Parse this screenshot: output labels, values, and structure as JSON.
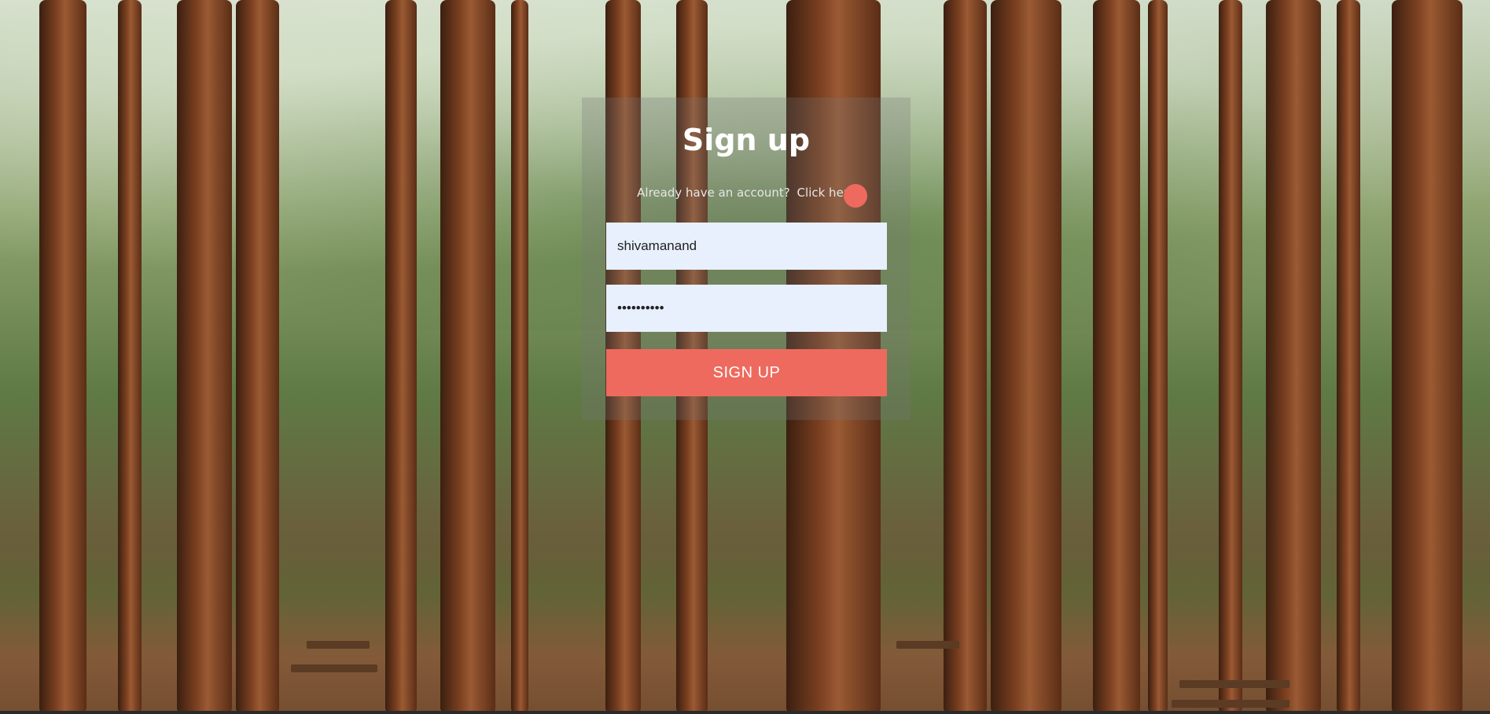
{
  "background": {
    "description_icon": "forest-background-image"
  },
  "signup": {
    "title": "Sign up",
    "login_prompt": "Already have an account?",
    "login_link": "Click here",
    "username_value": "shivamanand",
    "password_value": "passwords1",
    "submit_label": "SIGN UP"
  },
  "colors": {
    "accent": "#ee6a5e",
    "input_bg": "#e8f0fe",
    "title": "#ffffff"
  }
}
